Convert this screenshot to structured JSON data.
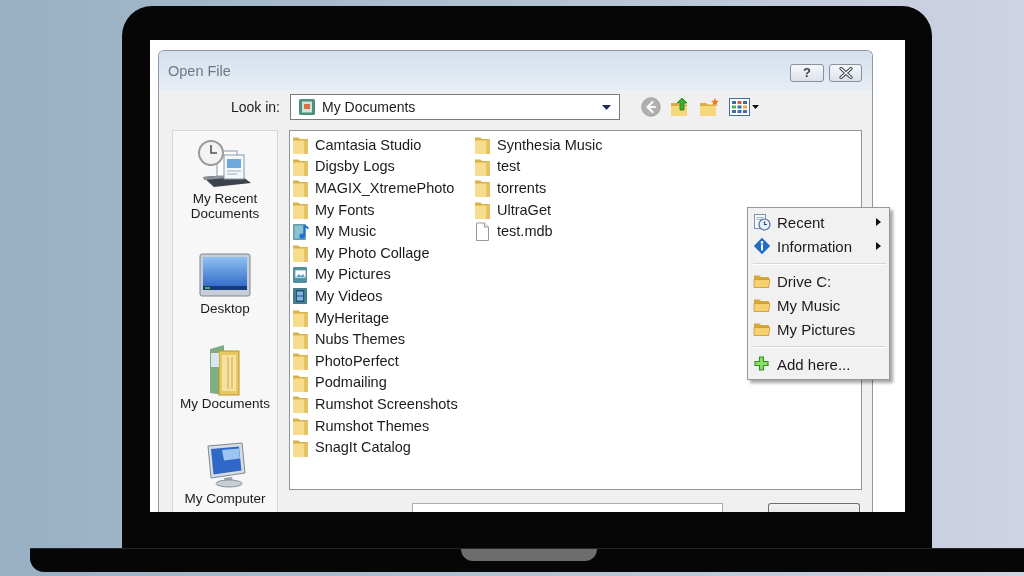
{
  "window": {
    "title": "Open File",
    "help_button": "?"
  },
  "look_in": {
    "label": "Look in:",
    "value": "My Documents"
  },
  "toolbar": [
    {
      "kind": "back",
      "disabled": true
    },
    {
      "kind": "up",
      "disabled": false
    },
    {
      "kind": "new_folder",
      "disabled": false
    },
    {
      "kind": "views",
      "disabled": false
    }
  ],
  "places": [
    {
      "kind": "recent",
      "label": "My Recent Documents"
    },
    {
      "kind": "desktop",
      "label": "Desktop"
    },
    {
      "kind": "documents",
      "label": "My Documents"
    },
    {
      "kind": "computer",
      "label": "My Computer"
    }
  ],
  "files": [
    {
      "kind": "folder",
      "name": "Camtasia Studio"
    },
    {
      "kind": "folder",
      "name": "Digsby Logs"
    },
    {
      "kind": "folder",
      "name": "MAGIX_XtremePhoto"
    },
    {
      "kind": "folder",
      "name": "My Fonts"
    },
    {
      "kind": "music",
      "name": "My Music"
    },
    {
      "kind": "folder",
      "name": "My Photo Collage"
    },
    {
      "kind": "pictures",
      "name": "My Pictures"
    },
    {
      "kind": "videos",
      "name": "My Videos"
    },
    {
      "kind": "folder",
      "name": "MyHeritage"
    },
    {
      "kind": "folder",
      "name": "Nubs Themes"
    },
    {
      "kind": "folder",
      "name": "PhotoPerfect"
    },
    {
      "kind": "folder",
      "name": "Podmailing"
    },
    {
      "kind": "folder",
      "name": "Rumshot Screenshots"
    },
    {
      "kind": "folder",
      "name": "Rumshot Themes"
    },
    {
      "kind": "folder",
      "name": "SnagIt Catalog"
    },
    {
      "kind": "folder",
      "name": "Synthesia Music"
    },
    {
      "kind": "folder",
      "name": "test"
    },
    {
      "kind": "folder",
      "name": "torrents"
    },
    {
      "kind": "folder",
      "name": "UltraGet"
    },
    {
      "kind": "file",
      "name": "test.mdb"
    }
  ],
  "context_menu": {
    "sections": [
      {
        "items": [
          {
            "kind": "recent",
            "label": "Recent",
            "submenu": true
          },
          {
            "kind": "info",
            "label": "Information",
            "submenu": true
          }
        ]
      },
      {
        "items": [
          {
            "kind": "folder",
            "label": "Drive C:",
            "submenu": false
          },
          {
            "kind": "folder",
            "label": "My Music",
            "submenu": false
          },
          {
            "kind": "folder",
            "label": "My Pictures",
            "submenu": false
          }
        ]
      },
      {
        "items": [
          {
            "kind": "add",
            "label": "Add here...",
            "submenu": false
          }
        ]
      }
    ]
  }
}
